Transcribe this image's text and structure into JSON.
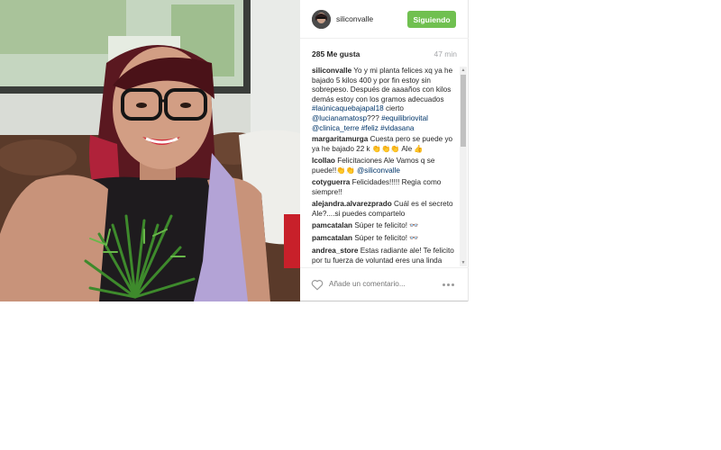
{
  "post": {
    "username": "siliconvalle",
    "follow_label": "Siguiendo",
    "likes": "285 Me gusta",
    "time": "47 min",
    "add_comment_placeholder": "Añade un comentario...",
    "icons": {
      "heart": "heart-outline-icon",
      "more": "more-options-icon"
    },
    "colors": {
      "follow_button": "#70c050",
      "hashtag": "#003569",
      "meta_text": "#a5a7aa"
    }
  },
  "caption": {
    "user": "siliconvalle",
    "part1": "Yo y mi planta felices xq ya he bajado 5 kilos 400 y por fin estoy sin sobrepeso. Después de aaaaños con kilos demás estoy con los gramos adecuados",
    "tag1": "#laúnicaquebajapal18",
    "part2": "cierto",
    "tag2": "@lucianamatosp",
    "part3": "???",
    "tag3": "#equilibriovital",
    "tag4": "@clinica_terre",
    "tag5": "#feliz",
    "tag6": "#vidasana"
  },
  "comments": [
    {
      "user": "margaritamurga",
      "text": "Cuesta pero se puede yo ya he bajado 22 k 👏👏👏 Ale 👍"
    },
    {
      "user": "lcollao",
      "text": "Felicitaciones Ale Vamos q se puede!!👏👏",
      "tag": "@siliconvalle"
    },
    {
      "user": "cotyguerra",
      "text": "Felicidades!!!!! Regia como siempre!!"
    },
    {
      "user": "alejandra.alvarezprado",
      "text": "Cuál es el secreto Ale?....si puedes compartelo"
    },
    {
      "user": "pamcatalan",
      "text": "Súper te felicito! 👓"
    },
    {
      "user": "pamcatalan",
      "text": "Súper te felicito! 👓"
    },
    {
      "user": "andrea_store",
      "text": "Estas radiante ale! Te felicito por tu fuerza de voluntad eres una linda inspiración"
    }
  ]
}
